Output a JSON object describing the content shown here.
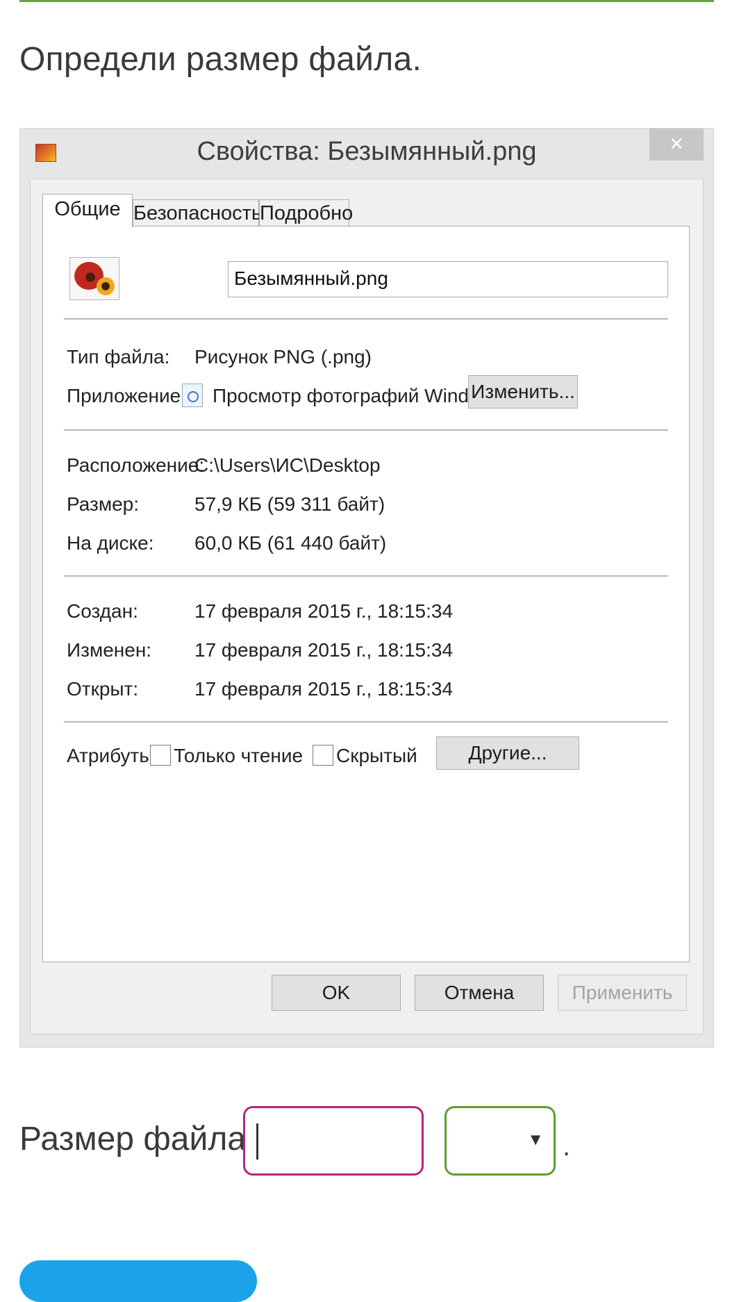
{
  "task": {
    "text": "Определи размер файла."
  },
  "dialog": {
    "title": "Свойства: Безымянный.png",
    "close_glyph": "×",
    "tabs": [
      "Общие",
      "Безопасность",
      "Подробно"
    ],
    "file_name": "Безымянный.png",
    "rows": {
      "type_label": "Тип файла:",
      "type_value": "Рисунок PNG (.png)",
      "app_label": "Приложение:",
      "app_value": "Просмотр фотографий Windows",
      "change_button": "Изменить...",
      "location_label": "Расположение:",
      "location_value": "C:\\Users\\ИС\\Desktop",
      "size_label": "Размер:",
      "size_value": "57,9 КБ (59 311 байт)",
      "disk_label": "На диске:",
      "disk_value": "60,0 КБ (61 440 байт)",
      "created_label": "Создан:",
      "created_value": "17 февраля 2015 г., 18:15:34",
      "modified_label": "Изменен:",
      "modified_value": "17 февраля 2015 г., 18:15:34",
      "opened_label": "Открыт:",
      "opened_value": "17 февраля 2015 г., 18:15:34",
      "attributes_label": "Атрибуты:",
      "readonly_label": "Только чтение",
      "hidden_label": "Скрытый",
      "other_button": "Другие..."
    },
    "buttons": {
      "ok": "OK",
      "cancel": "Отмена",
      "apply": "Применить"
    }
  },
  "answer": {
    "label": "Размер файла:",
    "input_value": "",
    "unit_selected": "",
    "arrow_glyph": "▼",
    "period": "."
  },
  "colors": {
    "accent_green": "#5aa02c",
    "input_border": "#b0287a",
    "blue_button": "#1aa3e8"
  }
}
